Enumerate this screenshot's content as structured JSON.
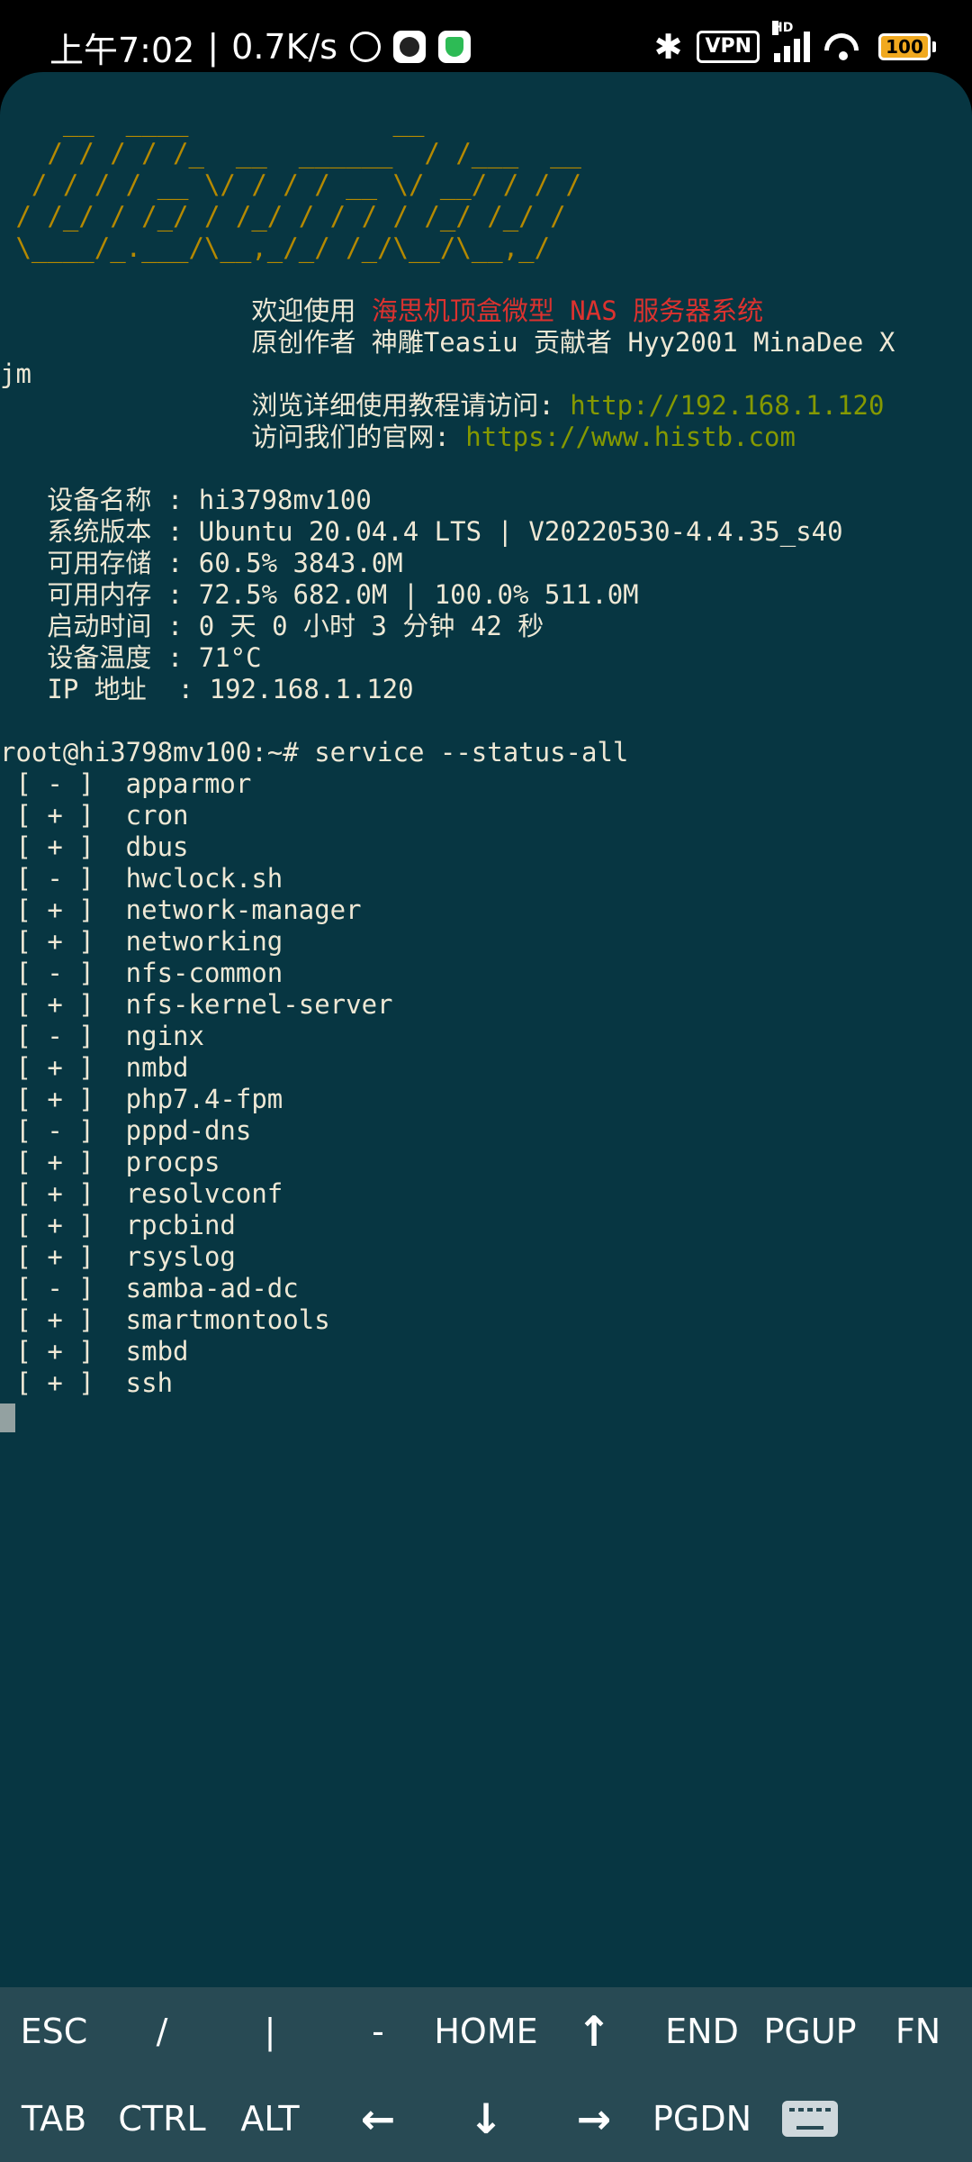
{
  "status_bar": {
    "time": "上午7:02",
    "net_speed": "0.7K/s",
    "vpn": "VPN",
    "signal_hd": "HD",
    "battery": "100"
  },
  "terminal": {
    "lines": [
      {
        "segments": [
          {
            "text": "    __  ____             __",
            "style": "art"
          }
        ]
      },
      {
        "segments": [
          {
            "text": "   / / / / /_  __  ______  / /___  __",
            "style": "art"
          }
        ]
      },
      {
        "segments": [
          {
            "text": "  / / / / __ \\/ / / / __ \\/ __/ / / /",
            "style": "art"
          }
        ]
      },
      {
        "segments": [
          {
            "text": " / /_/ / /_/ / /_/ / / / / /_/ /_/ /",
            "style": "art"
          }
        ]
      },
      {
        "segments": [
          {
            "text": " \\____/_.___/\\__,_/_/ /_/\\__/\\__,_/",
            "style": "art"
          }
        ]
      },
      {
        "segments": [
          {
            "text": ""
          }
        ]
      },
      {
        "segments": [
          {
            "text": "                欢迎使用 "
          },
          {
            "text": "海思机顶盒微型 NAS 服务器系统",
            "style": "red"
          }
        ]
      },
      {
        "segments": [
          {
            "text": "                原创作者 神雕Teasiu 贡献者 Hyy2001 MinaDee X"
          }
        ]
      },
      {
        "segments": [
          {
            "text": "jm"
          }
        ]
      },
      {
        "segments": [
          {
            "text": "                浏览详细使用教程请访问: "
          },
          {
            "text": "http://192.168.1.120",
            "style": "link"
          }
        ]
      },
      {
        "segments": [
          {
            "text": "                访问我们的官网: "
          },
          {
            "text": "https://www.histb.com",
            "style": "link"
          }
        ]
      },
      {
        "segments": [
          {
            "text": ""
          }
        ]
      },
      {
        "segments": [
          {
            "text": "   设备名称 : hi3798mv100"
          }
        ]
      },
      {
        "segments": [
          {
            "text": "   系统版本 : Ubuntu 20.04.4 LTS | V20220530-4.4.35_s40"
          }
        ]
      },
      {
        "segments": [
          {
            "text": "   可用存储 : 60.5% 3843.0M"
          }
        ]
      },
      {
        "segments": [
          {
            "text": "   可用内存 : 72.5% 682.0M | 100.0% 511.0M"
          }
        ]
      },
      {
        "segments": [
          {
            "text": "   启动时间 : 0 天 0 小时 3 分钟 42 秒"
          }
        ]
      },
      {
        "segments": [
          {
            "text": "   设备温度 : 71°C"
          }
        ]
      },
      {
        "segments": [
          {
            "text": "   IP 地址  : 192.168.1.120"
          }
        ]
      },
      {
        "segments": [
          {
            "text": ""
          }
        ]
      },
      {
        "segments": [
          {
            "text": "root@hi3798mv100:~# service --status-all"
          }
        ]
      },
      {
        "segments": [
          {
            "text": " [ - ]  apparmor"
          }
        ]
      },
      {
        "segments": [
          {
            "text": " [ + ]  cron"
          }
        ]
      },
      {
        "segments": [
          {
            "text": " [ + ]  dbus"
          }
        ]
      },
      {
        "segments": [
          {
            "text": " [ - ]  hwclock.sh"
          }
        ]
      },
      {
        "segments": [
          {
            "text": " [ + ]  network-manager"
          }
        ]
      },
      {
        "segments": [
          {
            "text": " [ + ]  networking"
          }
        ]
      },
      {
        "segments": [
          {
            "text": " [ - ]  nfs-common"
          }
        ]
      },
      {
        "segments": [
          {
            "text": " [ + ]  nfs-kernel-server"
          }
        ]
      },
      {
        "segments": [
          {
            "text": " [ - ]  nginx"
          }
        ]
      },
      {
        "segments": [
          {
            "text": " [ + ]  nmbd"
          }
        ]
      },
      {
        "segments": [
          {
            "text": " [ + ]  php7.4-fpm"
          }
        ]
      },
      {
        "segments": [
          {
            "text": " [ - ]  pppd-dns"
          }
        ]
      },
      {
        "segments": [
          {
            "text": " [ + ]  procps"
          }
        ]
      },
      {
        "segments": [
          {
            "text": " [ + ]  resolvconf"
          }
        ]
      },
      {
        "segments": [
          {
            "text": " [ + ]  rpcbind"
          }
        ]
      },
      {
        "segments": [
          {
            "text": " [ + ]  rsyslog"
          }
        ]
      },
      {
        "segments": [
          {
            "text": " [ - ]  samba-ad-dc"
          }
        ]
      },
      {
        "segments": [
          {
            "text": " [ + ]  smartmontools"
          }
        ]
      },
      {
        "segments": [
          {
            "text": " [ + ]  smbd"
          }
        ]
      },
      {
        "segments": [
          {
            "text": " [ + ]  ssh"
          }
        ]
      }
    ]
  },
  "extra_keys": {
    "row1": [
      "ESC",
      "/",
      "|",
      "-",
      "HOME",
      "↑",
      "END",
      "PGUP",
      "FN"
    ],
    "row2": [
      "TAB",
      "CTRL",
      "ALT",
      "←",
      "↓",
      "→",
      "PGDN"
    ]
  },
  "colors": {
    "terminal_bg": "#073642",
    "extra_keys_bg": "#284a54",
    "ascii_art": "#b58900",
    "highlight_red": "#dc322f",
    "link_green": "#859900"
  },
  "icons": {
    "alarm": "alarm-icon",
    "bluetooth": "bluetooth-icon",
    "wifi": "wifi-icon",
    "keyboard": "keyboard-icon"
  }
}
